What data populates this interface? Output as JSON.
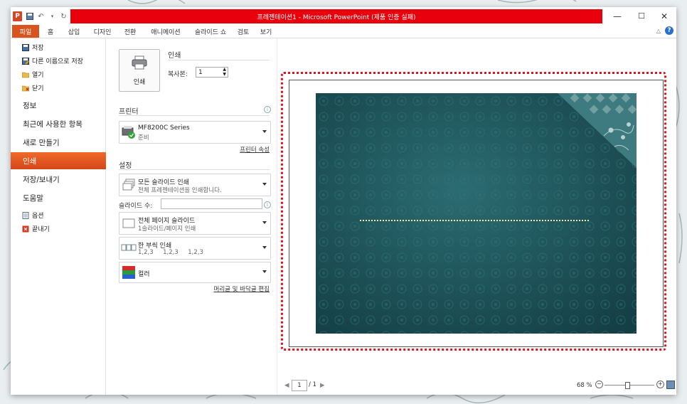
{
  "window": {
    "title": "프레젠테이션1 - Microsoft PowerPoint (제품 인증 실패)",
    "qat_icon": "P",
    "controls": {
      "minimize": "—",
      "maximize": "☐",
      "close": "✕"
    }
  },
  "ribbon": {
    "tabs": [
      "파일",
      "홈",
      "삽입",
      "디자인",
      "전환",
      "애니메이션",
      "슬라이드 쇼",
      "검토",
      "보기"
    ],
    "help": "?"
  },
  "nav": {
    "small_top": [
      {
        "label": "저장",
        "icon": "save-icon"
      },
      {
        "label": "다른 이름으로 저장",
        "icon": "save-as-icon"
      },
      {
        "label": "열기",
        "icon": "open-folder-icon"
      },
      {
        "label": "닫기",
        "icon": "close-folder-icon"
      }
    ],
    "big": [
      "정보",
      "최근에 사용한 항목",
      "새로 만들기",
      "인쇄",
      "저장/보내기",
      "도움말"
    ],
    "active": "인쇄",
    "small_bottom": [
      {
        "label": "옵션",
        "icon": "options-icon"
      },
      {
        "label": "끝내기",
        "icon": "exit-icon"
      }
    ]
  },
  "print": {
    "title": "인쇄",
    "button_label": "인쇄",
    "copies_label": "복사본:",
    "copies_value": "1",
    "printer_section": "프린터",
    "printer_name": "MF8200C Series",
    "printer_status": "준비",
    "printer_properties_link": "프린터 속성",
    "settings_section": "설정",
    "range_title": "모든 슬라이드 인쇄",
    "range_desc": "전체 프레젠테이션을 인쇄합니다.",
    "slides_label": "슬라이드 수:",
    "slides_value": "",
    "layout_title": "전체 페이지 슬라이드",
    "layout_desc": "1슬라이드/페이지 인쇄",
    "collate_title": "한 부씩 인쇄",
    "collate_desc": "1,2,3     1,2,3     1,2,3",
    "color_title": "컬러",
    "header_footer_link": "머리글 및 바닥글 편집"
  },
  "preview": {
    "page_value": "1",
    "page_total": "/ 1",
    "zoom_label": "68 %",
    "zoom_level": 0.45
  },
  "colors": {
    "accent_file_tab": "#d9531e",
    "title_red": "#e8000d",
    "slide_teal": "#1f5a60",
    "highlight_red": "#e0141e"
  }
}
